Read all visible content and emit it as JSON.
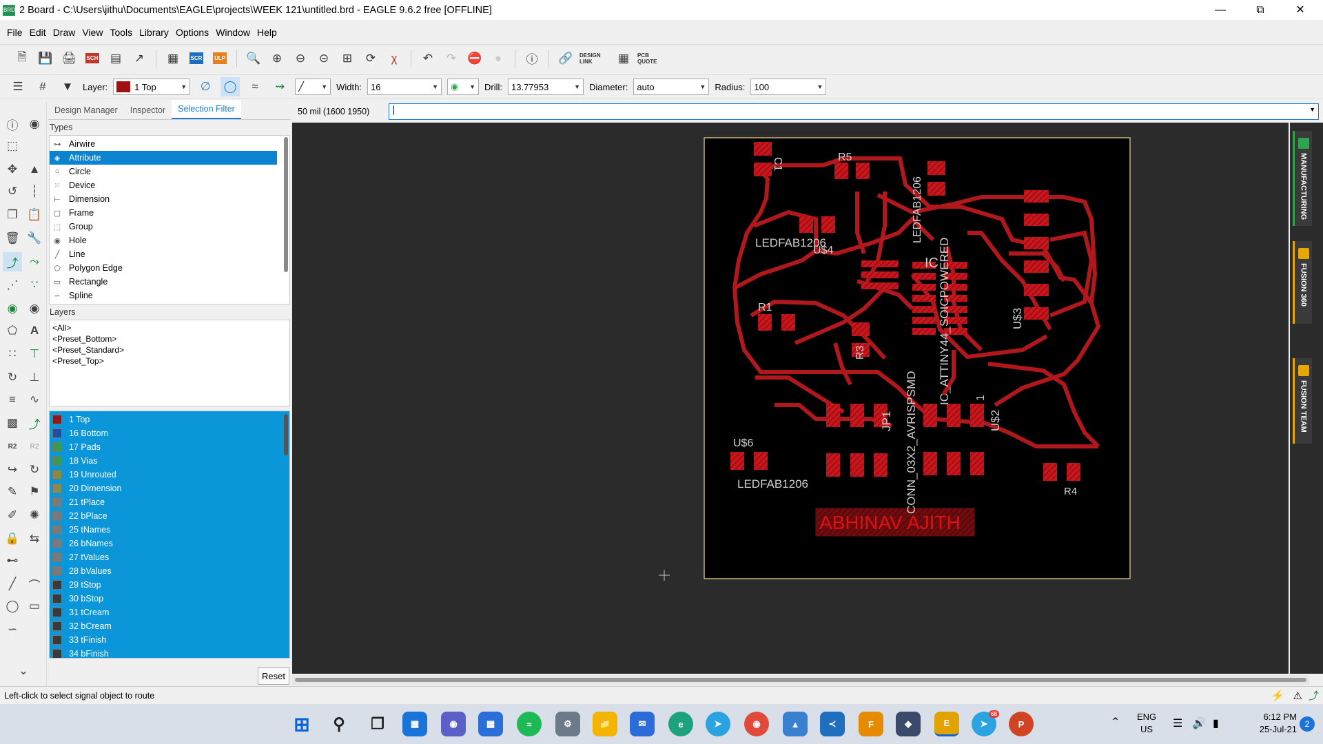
{
  "window": {
    "title": "2 Board - C:\\Users\\jithu\\Documents\\EAGLE\\projects\\WEEK 121\\untitled.brd - EAGLE 9.6.2 free [OFFLINE]",
    "app_icon": "BRD"
  },
  "menu": [
    "File",
    "Edit",
    "Draw",
    "View",
    "Tools",
    "Library",
    "Options",
    "Window",
    "Help"
  ],
  "toolbar1": {
    "design_link": "DESIGN LINK",
    "pcb_quote": "PCB QUOTE",
    "scr": "SCR",
    "ulp": "ULP",
    "sch": "SCH"
  },
  "toolbar2": {
    "layer_label": "Layer:",
    "layer_value": "1 Top",
    "layer_color": "#a01010",
    "width_label": "Width:",
    "width_value": "16",
    "drill_label": "Drill:",
    "drill_value": "13.77953",
    "diameter_label": "Diameter:",
    "diameter_value": "auto",
    "radius_label": "Radius:",
    "radius_value": "100"
  },
  "panel": {
    "tabs": [
      "Design Manager",
      "Inspector",
      "Selection Filter"
    ],
    "active_tab": "Selection Filter",
    "types_header": "Types",
    "types": [
      {
        "label": "Airwire",
        "icon": "airwire-icon",
        "glyph": "⊶"
      },
      {
        "label": "Attribute",
        "icon": "attribute-icon",
        "glyph": "◈",
        "selected": true
      },
      {
        "label": "Circle",
        "icon": "circle-icon",
        "glyph": "○"
      },
      {
        "label": "Device",
        "icon": "device-icon",
        "glyph": "⁙"
      },
      {
        "label": "Dimension",
        "icon": "dimension-icon",
        "glyph": "⊢"
      },
      {
        "label": "Frame",
        "icon": "frame-icon",
        "glyph": "▢"
      },
      {
        "label": "Group",
        "icon": "group-icon",
        "glyph": "⬚"
      },
      {
        "label": "Hole",
        "icon": "hole-icon",
        "glyph": "◉"
      },
      {
        "label": "Line",
        "icon": "line-icon",
        "glyph": "╱"
      },
      {
        "label": "Polygon Edge",
        "icon": "polygon-edge-icon",
        "glyph": "⬠"
      },
      {
        "label": "Rectangle",
        "icon": "rectangle-icon",
        "glyph": "▭"
      },
      {
        "label": "Spline",
        "icon": "spline-icon",
        "glyph": "∽"
      }
    ],
    "layers_header": "Layers",
    "presets": [
      "<All>",
      "<Preset_Bottom>",
      "<Preset_Standard>",
      "<Preset_Top>"
    ],
    "layers": [
      {
        "label": "1 Top",
        "color": "#8b1a1a"
      },
      {
        "label": "16 Bottom",
        "color": "#1f4fa0"
      },
      {
        "label": "17 Pads",
        "color": "#3a9a50"
      },
      {
        "label": "18 Vias",
        "color": "#3a9a50"
      },
      {
        "label": "19 Unrouted",
        "color": "#8a8a3a"
      },
      {
        "label": "20 Dimension",
        "color": "#8a8a50"
      },
      {
        "label": "21 tPlace",
        "color": "#7a7a7a"
      },
      {
        "label": "22 bPlace",
        "color": "#7a7a7a"
      },
      {
        "label": "25 tNames",
        "color": "#7a7a7a"
      },
      {
        "label": "26 bNames",
        "color": "#7a7a7a"
      },
      {
        "label": "27 tValues",
        "color": "#7a7a7a"
      },
      {
        "label": "28 bValues",
        "color": "#7a7a7a"
      },
      {
        "label": "29 tStop",
        "color": "#3a3a3a"
      },
      {
        "label": "30 bStop",
        "color": "#3a3a3a"
      },
      {
        "label": "31 tCream",
        "color": "#3a3a3a"
      },
      {
        "label": "32 bCream",
        "color": "#3a3a3a"
      },
      {
        "label": "33 tFinish",
        "color": "#3a3a3a"
      },
      {
        "label": "34 bFinish",
        "color": "#3a3a3a"
      }
    ],
    "reset_label": "Reset"
  },
  "command": {
    "coordinate": "50 mil (1600 1950)",
    "input_value": ""
  },
  "board": {
    "labels": {
      "c1": "C1",
      "r5": "R5",
      "led_top": "LEDFAB1206",
      "us4": "U$4",
      "r1": "R1",
      "r3": "R3",
      "ic_text": "IC_ATTINY44_SOICPOWERED",
      "ic": "IC",
      "ledfab_v": "LEDFAB1206",
      "us3": "U$3",
      "conn": "CONN_03X2_AVRISPSMD",
      "jp1": "JP1",
      "us2_num": "1",
      "us2": "U$2",
      "us6": "U$6",
      "led_bottom": "LEDFAB1206",
      "r4": "R4",
      "name": "ABHINAV AJITH"
    },
    "trace_color": "#b0181c",
    "board_bg": "#000000",
    "outline_color": "#c8b27a"
  },
  "side_tabs": [
    "MANUFACTURING",
    "FUSION 360",
    "FUSION TEAM"
  ],
  "status": {
    "message": "Left-click to select signal object to route"
  },
  "taskbar": {
    "lang1": "ENG",
    "lang2": "US",
    "time": "6:12 PM",
    "date": "25-Jul-21",
    "notif_count": "2",
    "telegram_badge": "68"
  }
}
